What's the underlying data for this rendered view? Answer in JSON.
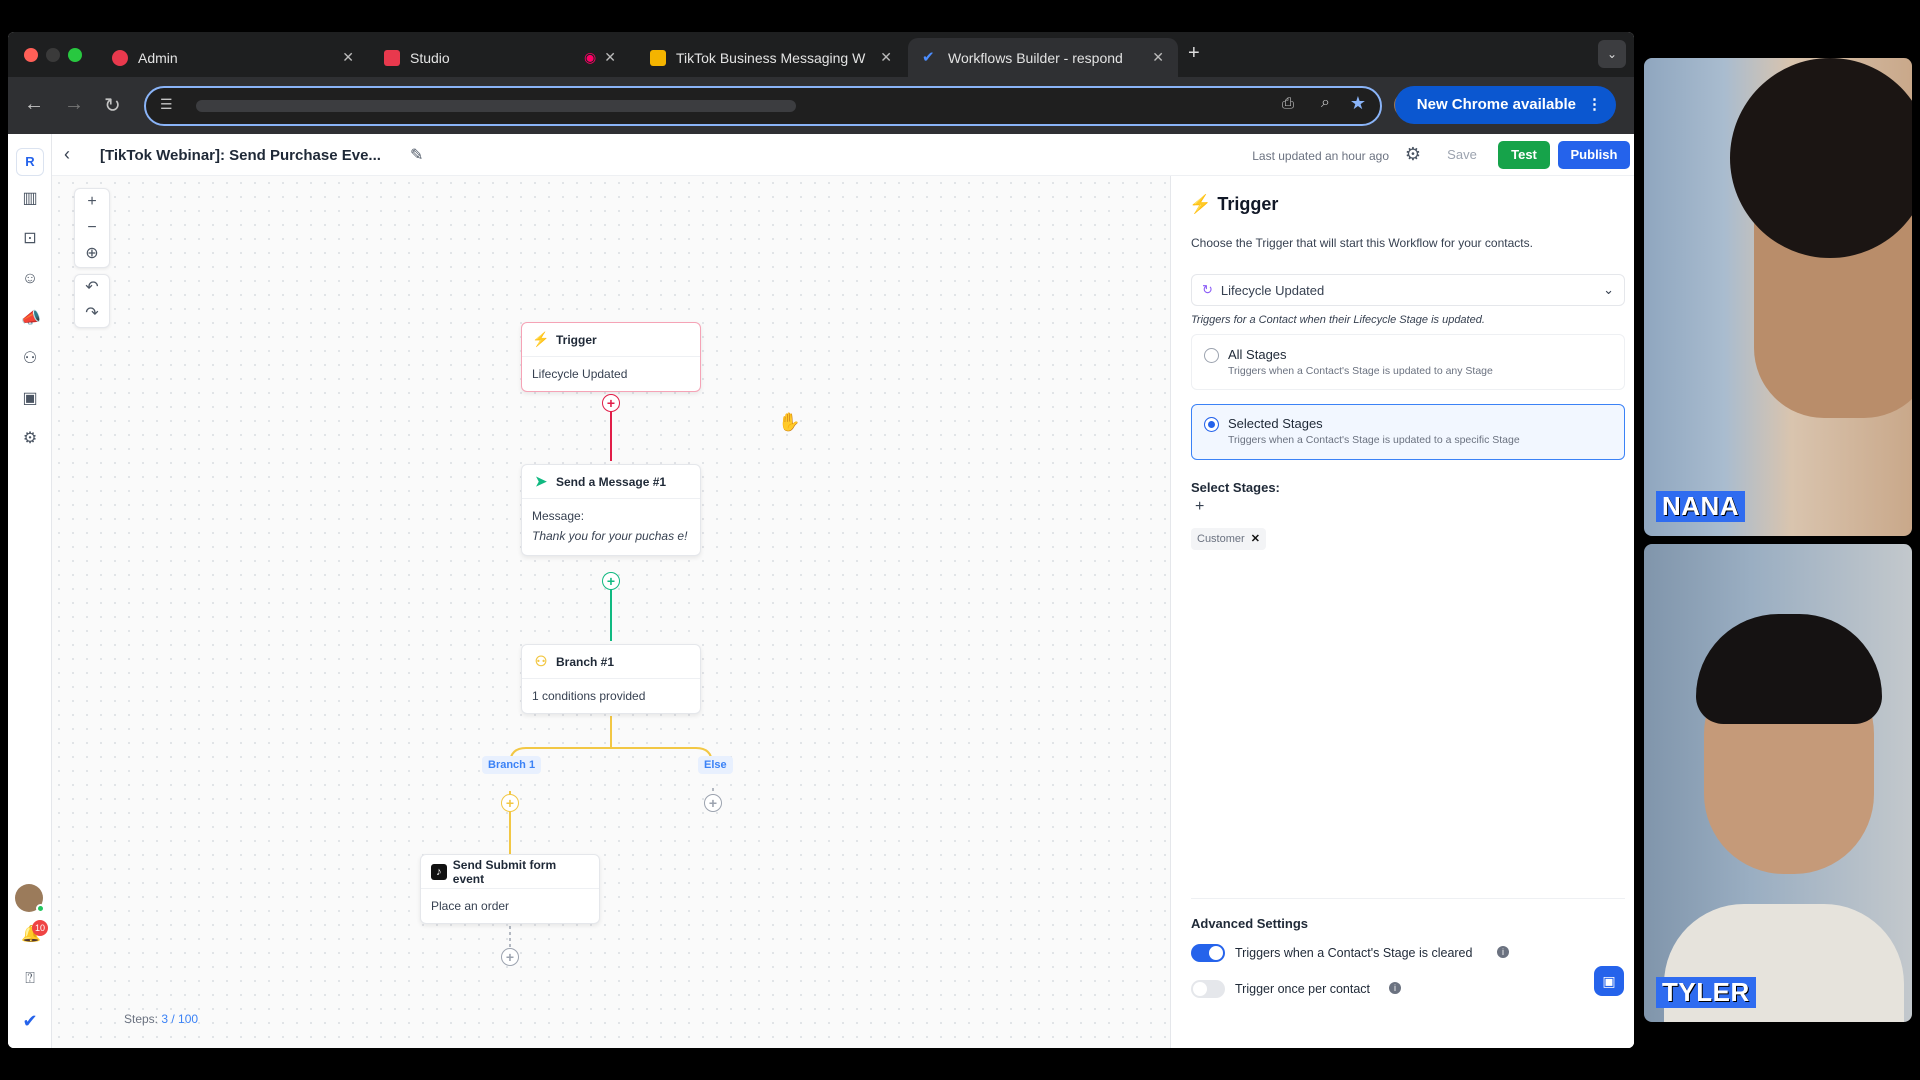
{
  "browser": {
    "tabs": [
      {
        "label": "Admin"
      },
      {
        "label": "Studio"
      },
      {
        "label": "TikTok Business Messaging W"
      },
      {
        "label": "Workflows Builder - respond"
      }
    ],
    "new_chrome": "New Chrome available"
  },
  "header": {
    "title": "[TikTok Webinar]: Send Purchase Eve...",
    "last_updated": "Last updated an hour ago",
    "save": "Save",
    "test": "Test",
    "publish": "Publish"
  },
  "sidebar": {
    "logo": "R",
    "notification_count": "10"
  },
  "canvas": {
    "nodes": {
      "trigger": {
        "title": "Trigger",
        "body": "Lifecycle Updated"
      },
      "message": {
        "title": "Send a Message #1",
        "label": "Message:",
        "text": "Thank you for your puchas e!"
      },
      "branch": {
        "title": "Branch #1",
        "body": "1 conditions provided"
      },
      "submit": {
        "title": "Send Submit form event",
        "body": "Place an order"
      }
    },
    "branch_labels": {
      "branch1": "Branch 1",
      "else": "Else"
    },
    "steps_label": "Steps:",
    "steps_value": "3 / 100"
  },
  "panel": {
    "title": "Trigger",
    "description": "Choose the Trigger that will start this Workflow for your contacts.",
    "selected_trigger": "Lifecycle Updated",
    "hint": "Triggers for a Contact when their Lifecycle Stage is updated.",
    "options": [
      {
        "label": "All Stages",
        "desc": "Triggers when a Contact's Stage is updated to any Stage",
        "selected": false
      },
      {
        "label": "Selected Stages",
        "desc": "Triggers when a Contact's Stage is updated to a specific Stage",
        "selected": true
      }
    ],
    "select_stages_label": "Select Stages:",
    "stage_tag": "Customer",
    "advanced_title": "Advanced Settings",
    "settings": [
      {
        "label": "Triggers when a Contact's Stage is cleared",
        "enabled": true
      },
      {
        "label": "Trigger once per contact",
        "enabled": false
      }
    ]
  },
  "participants": [
    {
      "name": "NANA"
    },
    {
      "name": "TYLER"
    }
  ],
  "colors": {
    "accent": "#2563eb",
    "test_green": "#16a34a",
    "trigger_red": "#e11d48",
    "message_green": "#10b981",
    "branch_yellow": "#f2c744"
  }
}
